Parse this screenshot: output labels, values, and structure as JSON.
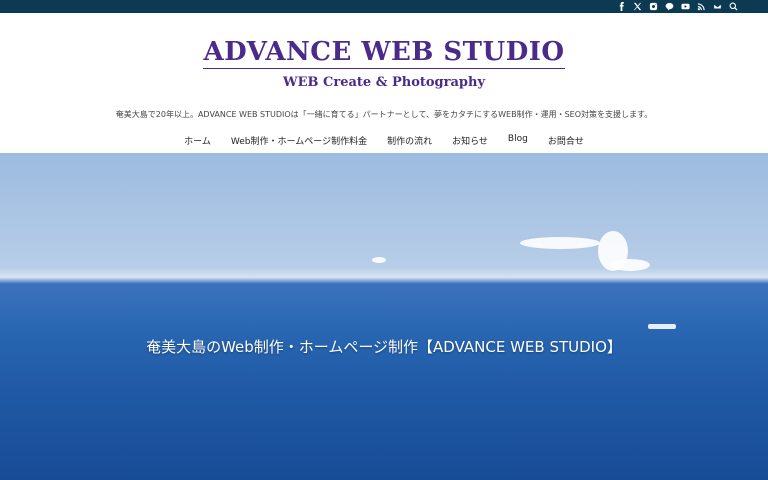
{
  "topbar": {
    "icons": [
      "facebook-icon",
      "x-icon",
      "instagram-icon",
      "line-icon",
      "youtube-icon",
      "rss-icon",
      "mail-icon",
      "search-icon"
    ]
  },
  "header": {
    "logo_title": "ADVANCE WEB STUDIO",
    "logo_subtitle": "WEB Create & Photography",
    "tagline": "奄美大島で20年以上。ADVANCE WEB STUDIOは「一緒に育てる」パートナーとして、夢をカタチにするWEB制作・運用・SEO対策を支援します。"
  },
  "nav": {
    "items": [
      "ホーム",
      "Web制作・ホームページ制作料金",
      "制作の流れ",
      "お知らせ",
      "Blog",
      "お問合せ"
    ]
  },
  "hero": {
    "title": "奄美大島のWeb制作・ホームページ制作【ADVANCE WEB STUDIO】"
  },
  "colors": {
    "topbar": "#0b3a52",
    "brand": "#4a2a8a",
    "sea": "#2866b2"
  }
}
